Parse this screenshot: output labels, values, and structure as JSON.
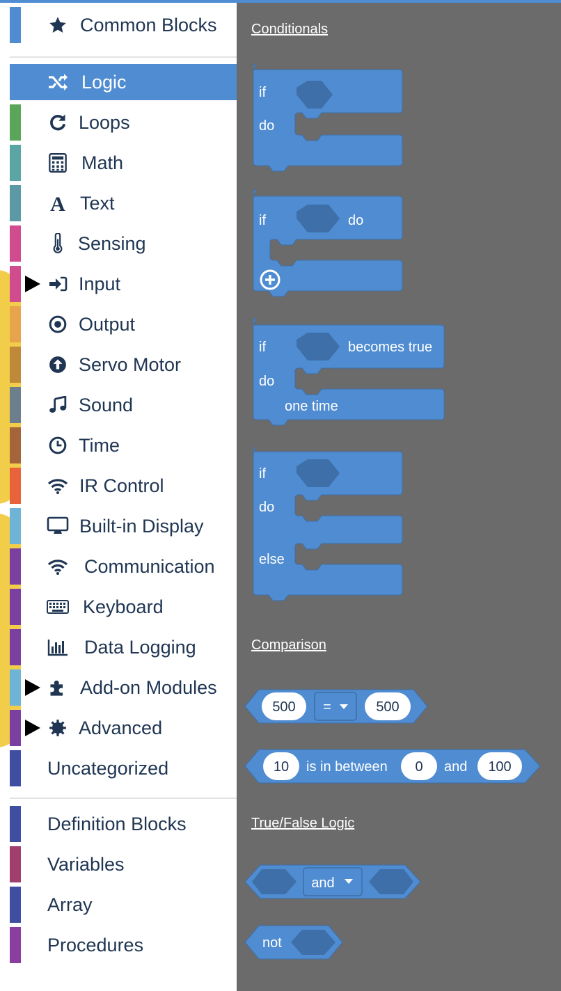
{
  "sidebar": {
    "items": [
      {
        "label": "Common Blocks",
        "icon": "star-icon",
        "color": "#4f8cd1"
      },
      {
        "label": "Logic",
        "icon": "shuffle-icon",
        "color": "#4f8cd1",
        "active": true
      },
      {
        "label": "Loops",
        "icon": "refresh-icon",
        "color": "#5ba55b"
      },
      {
        "label": "Math",
        "icon": "calculator-icon",
        "color": "#5ba5a5"
      },
      {
        "label": "Text",
        "icon": "font-icon",
        "color": "#5b9aa5"
      },
      {
        "label": "Sensing",
        "icon": "thermometer-icon",
        "color": "#d14b8f"
      },
      {
        "label": "Input",
        "icon": "sign-in-icon",
        "color": "#d14b8f"
      },
      {
        "label": "Output",
        "icon": "dot-circle-icon",
        "color": "#e8a34d"
      },
      {
        "label": "Servo Motor",
        "icon": "arrow-circle-up-icon",
        "color": "#c0893a"
      },
      {
        "label": "Sound",
        "icon": "music-icon",
        "color": "#6d7f8c"
      },
      {
        "label": "Time",
        "icon": "clock-icon",
        "color": "#a5653a"
      },
      {
        "label": "IR Control",
        "icon": "wifi-icon",
        "color": "#e8633a"
      },
      {
        "label": "Built-in Display",
        "icon": "desktop-icon",
        "color": "#6fb4d6"
      },
      {
        "label": "Communication",
        "icon": "wifi-icon",
        "color": "#7a3fa0"
      },
      {
        "label": "Keyboard",
        "icon": "keyboard-icon",
        "color": "#7a3fa0"
      },
      {
        "label": "Data Logging",
        "icon": "bar-chart-icon",
        "color": "#7a3fa0"
      },
      {
        "label": "Add-on Modules",
        "icon": "puzzle-icon",
        "color": "#6fb4d6"
      },
      {
        "label": "Advanced",
        "icon": "gear-icon",
        "color": "#7a3fa0"
      },
      {
        "label": "Uncategorized",
        "icon": "",
        "color": "#3f4ea0"
      },
      {
        "label": "Definition Blocks",
        "icon": "",
        "color": "#3f4ea0"
      },
      {
        "label": "Variables",
        "icon": "",
        "color": "#a03f6d"
      },
      {
        "label": "Array",
        "icon": "",
        "color": "#3f4ea0"
      },
      {
        "label": "Procedures",
        "icon": "",
        "color": "#8a3fa0"
      }
    ]
  },
  "flyout": {
    "sections": {
      "conditionals": "Conditionals",
      "comparison": "Comparison",
      "truefalse": "True/False Logic"
    },
    "block1": {
      "if": "if",
      "do": "do"
    },
    "block2": {
      "if": "if",
      "do": "do"
    },
    "block3": {
      "if": "if",
      "becomes": "becomes true",
      "do": "do",
      "once": "one time"
    },
    "block4": {
      "if": "if",
      "do": "do",
      "else": "else"
    },
    "compare": {
      "left": "500",
      "op": "=",
      "right": "500"
    },
    "between": {
      "value": "10",
      "text": "is in between",
      "low": "0",
      "and": "and",
      "high": "100"
    },
    "andblock": {
      "op": "and"
    },
    "notblock": {
      "label": "not"
    }
  },
  "colors": {
    "logic": "#4f8cd1",
    "logic_dark": "#3f6fa8",
    "flyout_bg": "#6b6b6b"
  }
}
